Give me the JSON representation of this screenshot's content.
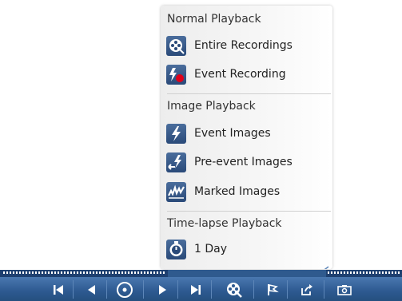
{
  "menu": {
    "sections": [
      {
        "title": "Normal Playback",
        "items": [
          {
            "label": "Entire Recordings",
            "icon": "film-reel-icon"
          },
          {
            "label": "Event Recording",
            "icon": "event-recording-icon"
          }
        ]
      },
      {
        "title": "Image Playback",
        "items": [
          {
            "label": "Event Images",
            "icon": "lightning-icon"
          },
          {
            "label": "Pre-event Images",
            "icon": "pre-event-icon"
          },
          {
            "label": "Marked Images",
            "icon": "marked-images-icon"
          }
        ]
      },
      {
        "title": "Time-lapse Playback",
        "items": [
          {
            "label": "1 Day",
            "icon": "timer-icon"
          }
        ]
      }
    ]
  },
  "toolbar": {
    "buttons": [
      "skip-to-start-icon",
      "step-back-icon",
      "record-icon",
      "play-icon",
      "skip-to-end-icon",
      "film-reel-icon",
      "mark-flag-icon",
      "export-icon",
      "snapshot-icon"
    ]
  },
  "colors": {
    "toolbar": "#2d5990",
    "icon_bg": "#3a5c8c",
    "record_dot": "#e0001a"
  }
}
